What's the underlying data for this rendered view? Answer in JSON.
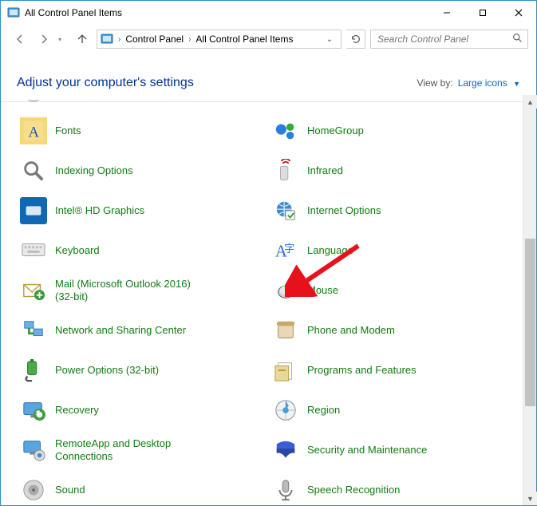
{
  "window": {
    "title": "All Control Panel Items"
  },
  "nav": {
    "breadcrumb": [
      "Control Panel",
      "All Control Panel Items"
    ],
    "search_placeholder": "Search Control Panel"
  },
  "header": {
    "title": "Adjust your computer's settings",
    "viewby_label": "View by:",
    "viewby_value": "Large icons"
  },
  "items_left": [
    {
      "icon": "fonts",
      "label": "Fonts"
    },
    {
      "icon": "indexing",
      "label": "Indexing Options"
    },
    {
      "icon": "intel",
      "label": "Intel® HD Graphics"
    },
    {
      "icon": "keyboard",
      "label": "Keyboard"
    },
    {
      "icon": "mail",
      "label": "Mail (Microsoft Outlook 2016) (32-bit)"
    },
    {
      "icon": "network",
      "label": "Network and Sharing Center"
    },
    {
      "icon": "power",
      "label": "Power Options (32-bit)"
    },
    {
      "icon": "recovery",
      "label": "Recovery"
    },
    {
      "icon": "remote",
      "label": "RemoteApp and Desktop Connections"
    },
    {
      "icon": "sound",
      "label": "Sound"
    }
  ],
  "items_right": [
    {
      "icon": "homegroup",
      "label": "HomeGroup"
    },
    {
      "icon": "infrared",
      "label": "Infrared"
    },
    {
      "icon": "internet",
      "label": "Internet Options"
    },
    {
      "icon": "language",
      "label": "Language"
    },
    {
      "icon": "mouse",
      "label": "Mouse"
    },
    {
      "icon": "phone",
      "label": "Phone and Modem"
    },
    {
      "icon": "programs",
      "label": "Programs and Features"
    },
    {
      "icon": "region",
      "label": "Region"
    },
    {
      "icon": "security",
      "label": "Security and Maintenance"
    },
    {
      "icon": "speech",
      "label": "Speech Recognition"
    }
  ],
  "annotation": {
    "target": "Mouse",
    "color": "#e6111a"
  }
}
